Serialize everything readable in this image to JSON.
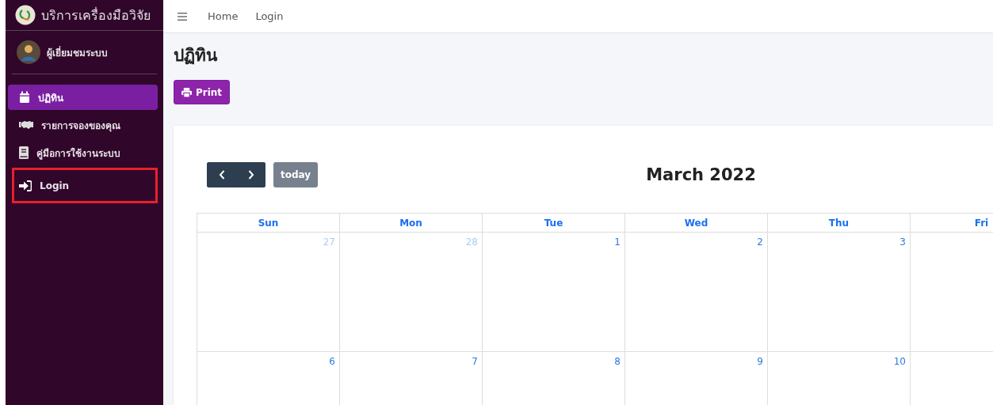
{
  "sidebar": {
    "brand": "บริการเครื่องมือวิจัย",
    "user": "ผู้เยี่ยมชมระบบ",
    "items": [
      {
        "label": "ปฏิทิน",
        "kind": "calendar",
        "selected": true,
        "highlighted": false
      },
      {
        "label": "รายการจองของคุณ",
        "kind": "handshake",
        "selected": false,
        "highlighted": false
      },
      {
        "label": "คู่มือการใช้งานระบบ",
        "kind": "book",
        "selected": false,
        "highlighted": false
      },
      {
        "label": "Login",
        "kind": "login",
        "selected": false,
        "highlighted": true
      }
    ]
  },
  "topbar": {
    "links": [
      "Home",
      "Login"
    ]
  },
  "page": {
    "title": "ปฏิทิน",
    "print_button": "Print"
  },
  "calendar": {
    "title": "March 2022",
    "today_button": "today",
    "columns": [
      "Sun",
      "Mon",
      "Tue",
      "Wed",
      "Thu",
      "Fri"
    ],
    "weeks": [
      {
        "days": [
          {
            "label": "27",
            "other_month": true
          },
          {
            "label": "28",
            "other_month": true
          },
          {
            "label": "1",
            "other_month": false
          },
          {
            "label": "2",
            "other_month": false
          },
          {
            "label": "3",
            "other_month": false
          }
        ]
      },
      {
        "days": [
          {
            "label": "6",
            "other_month": false
          },
          {
            "label": "7",
            "other_month": false
          },
          {
            "label": "8",
            "other_month": false
          },
          {
            "label": "9",
            "other_month": false
          },
          {
            "label": "10",
            "other_month": false
          }
        ]
      }
    ]
  }
}
